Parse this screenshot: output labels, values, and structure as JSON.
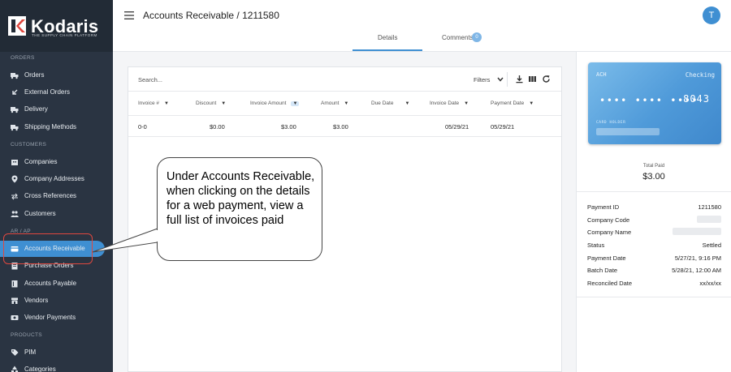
{
  "sidebar": {
    "logo_text": "Kodaris",
    "logo_tagline": "THE SUPPLY CHAIN PLATFORM",
    "sections": {
      "orders": "ORDERS",
      "customers": "CUSTOMERS",
      "ar_ap": "AR / AP",
      "products": "PRODUCTS"
    },
    "items": [
      {
        "label": "Orders",
        "icon": "truck-icon"
      },
      {
        "label": "External Orders",
        "icon": "arrow-in-icon"
      },
      {
        "label": "Delivery",
        "icon": "truck-icon"
      },
      {
        "label": "Shipping Methods",
        "icon": "truck-icon"
      },
      {
        "label": "Companies",
        "icon": "building-icon"
      },
      {
        "label": "Company Addresses",
        "icon": "location-pin-icon"
      },
      {
        "label": "Cross References",
        "icon": "swap-icon"
      },
      {
        "label": "Customers",
        "icon": "people-icon"
      },
      {
        "label": "Accounts Receivable",
        "icon": "card-icon",
        "active": true
      },
      {
        "label": "Purchase Orders",
        "icon": "document-icon"
      },
      {
        "label": "Accounts Payable",
        "icon": "ledger-icon"
      },
      {
        "label": "Vendors",
        "icon": "store-icon"
      },
      {
        "label": "Vendor Payments",
        "icon": "payment-icon"
      },
      {
        "label": "PIM",
        "icon": "tag-icon"
      },
      {
        "label": "Categories",
        "icon": "shapes-icon"
      }
    ],
    "accent": "#3f8fd2"
  },
  "header": {
    "title": "Accounts Receivable / 1211580",
    "avatar_initial": "T",
    "tabs": [
      {
        "label": "Details",
        "active": true
      },
      {
        "label": "Comments",
        "badge": "0"
      }
    ]
  },
  "table": {
    "search_placeholder": "Search...",
    "filters_label": "Filters",
    "columns": [
      "Invoice #",
      "Discount",
      "Invoice Amount",
      "Amount",
      "Due Date",
      "Invoice Date",
      "Payment Date"
    ],
    "rows": [
      {
        "invoice": "0-0",
        "discount": "$0.00",
        "invoice_amount": "$3.00",
        "amount": "$3.00",
        "due_date": "",
        "invoice_date": "05/29/21",
        "payment_date": "05/29/21"
      }
    ]
  },
  "payment": {
    "card_method": "ACH",
    "card_type": "Checking",
    "card_dots": "•••• •••• ••••",
    "card_last4": "8043",
    "card_holder_label": "CARD HOLDER",
    "total_paid_label": "Total Paid",
    "total_paid_value": "$3.00",
    "details": [
      {
        "label": "Payment ID",
        "value": "1211580"
      },
      {
        "label": "Company Code",
        "value": ""
      },
      {
        "label": "Company Name",
        "value": ""
      },
      {
        "label": "Status",
        "value": "Settled"
      },
      {
        "label": "Payment Date",
        "value": "5/27/21, 9:16 PM"
      },
      {
        "label": "Batch Date",
        "value": "5/28/21, 12:00 AM"
      },
      {
        "label": "Reconciled Date",
        "value": "xx/xx/xx"
      }
    ]
  },
  "annotation": {
    "text": "Under Accounts Receivable, when clicking on the details for a web payment, view a full list of invoices paid"
  }
}
